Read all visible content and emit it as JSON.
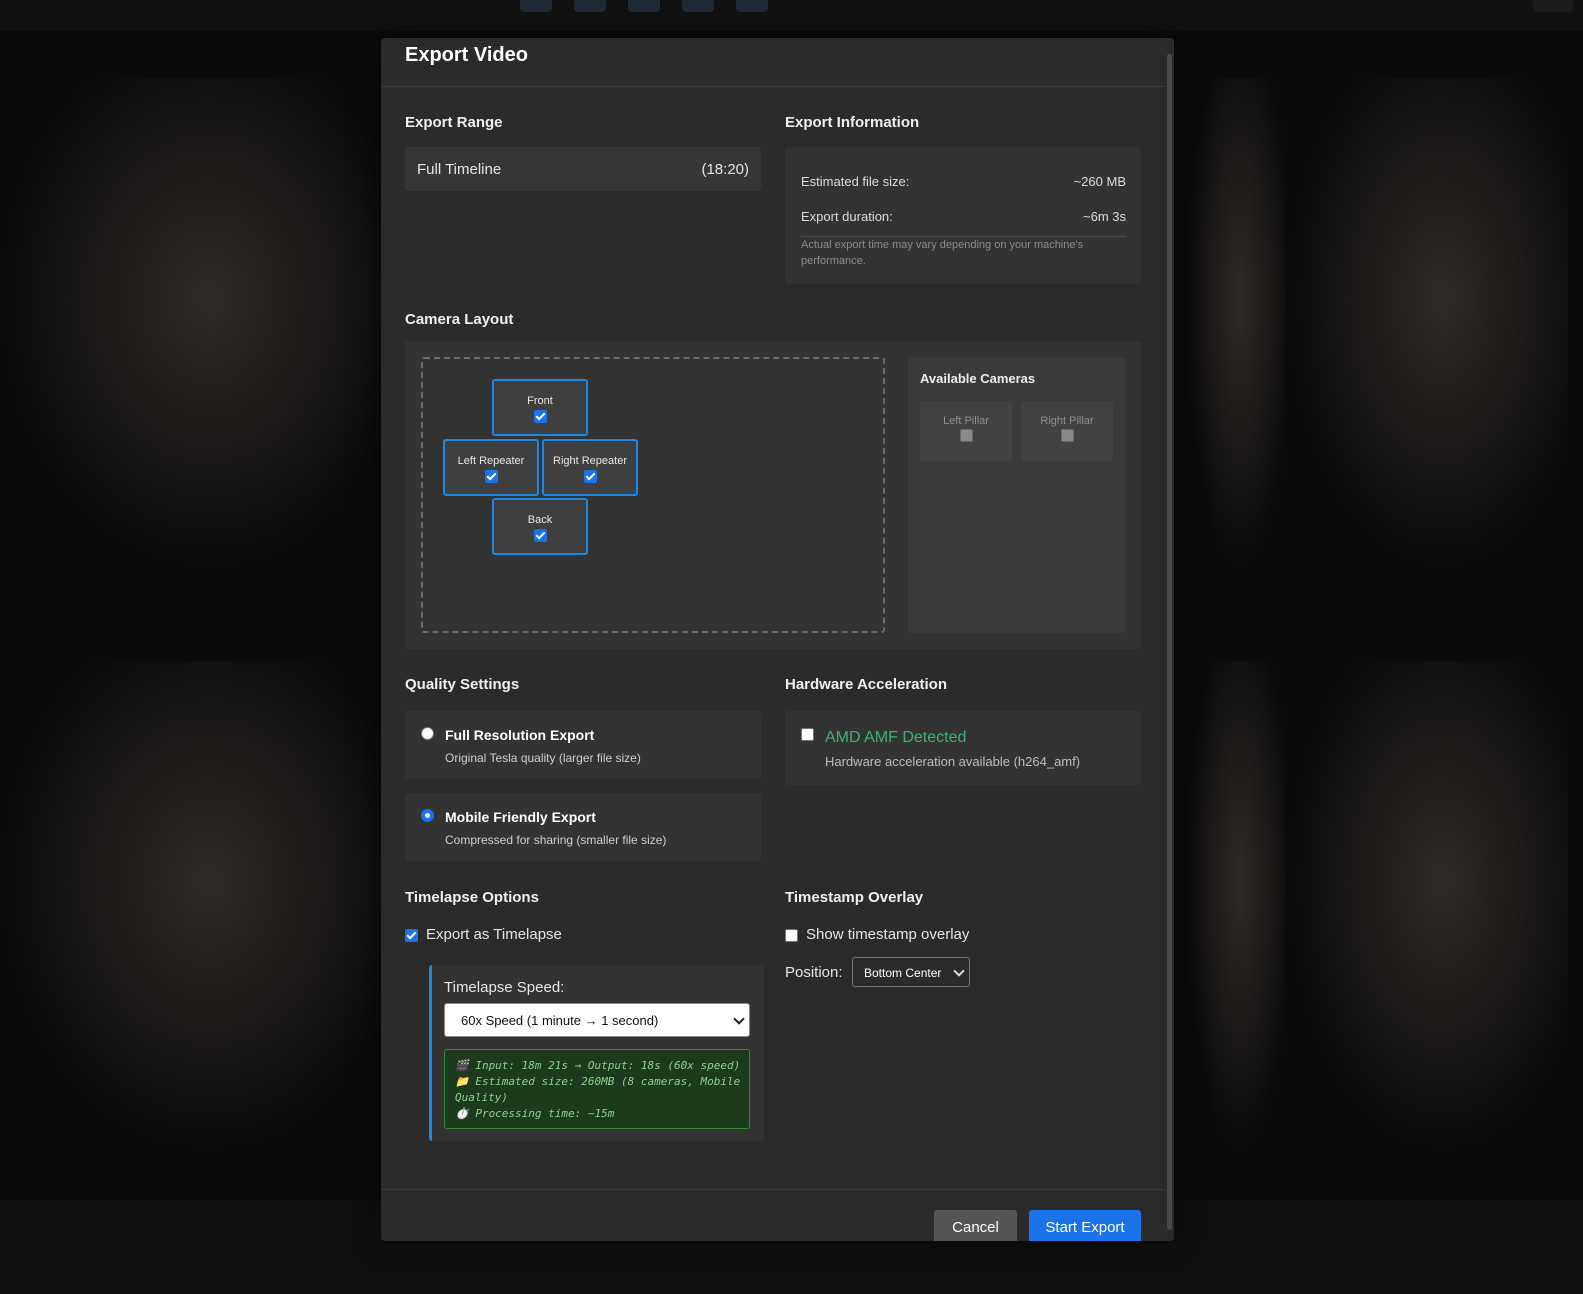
{
  "modal": {
    "title": "Export Video"
  },
  "export_range": {
    "heading": "Export Range",
    "label": "Full Timeline",
    "duration": "(18:20)"
  },
  "export_info": {
    "heading": "Export Information",
    "file_size_label": "Estimated file size:",
    "file_size_value": "~260 MB",
    "duration_label": "Export duration:",
    "duration_value": "~6m 3s",
    "note": "Actual export time may vary depending on your machine's performance."
  },
  "camera_layout": {
    "heading": "Camera Layout",
    "grid_cameras": [
      {
        "label": "Front",
        "checked": true
      },
      {
        "label": "Left Repeater",
        "checked": true
      },
      {
        "label": "Right Repeater",
        "checked": true
      },
      {
        "label": "Back",
        "checked": true
      }
    ],
    "available_title": "Available Cameras",
    "available_cameras": [
      {
        "label": "Left Pillar",
        "checked": false
      },
      {
        "label": "Right Pillar",
        "checked": false
      }
    ]
  },
  "quality": {
    "heading": "Quality Settings",
    "options": [
      {
        "title": "Full Resolution Export",
        "desc": "Original Tesla quality (larger file size)",
        "selected": false
      },
      {
        "title": "Mobile Friendly Export",
        "desc": "Compressed for sharing (smaller file size)",
        "selected": true
      }
    ]
  },
  "hardware": {
    "heading": "Hardware Acceleration",
    "title": "AMD AMF Detected",
    "desc": "Hardware acceleration available (h264_amf)",
    "checked": false,
    "accent": "#3cb371"
  },
  "timelapse": {
    "heading": "Timelapse Options",
    "checkbox_label": "Export as Timelapse",
    "checked": true,
    "speed_label": "Timelapse Speed:",
    "speed_value": "60x Speed (1 minute → 1 second)",
    "info_lines": [
      "🎬 Input: 18m 21s → Output: 18s (60x speed)",
      "📁 Estimated size: 260MB (8 cameras, Mobile",
      "Quality)",
      "⏱️ Processing time: ~15m"
    ]
  },
  "timestamp": {
    "heading": "Timestamp Overlay",
    "checkbox_label": "Show timestamp overlay",
    "checked": false,
    "position_label": "Position:",
    "position_value": "Bottom Center"
  },
  "footer": {
    "cancel_label": "Cancel",
    "start_label": "Start Export"
  },
  "colors": {
    "accent_blue": "#1a73e8",
    "modal_bg": "#2b2b2b",
    "success_green": "#3cb371"
  }
}
